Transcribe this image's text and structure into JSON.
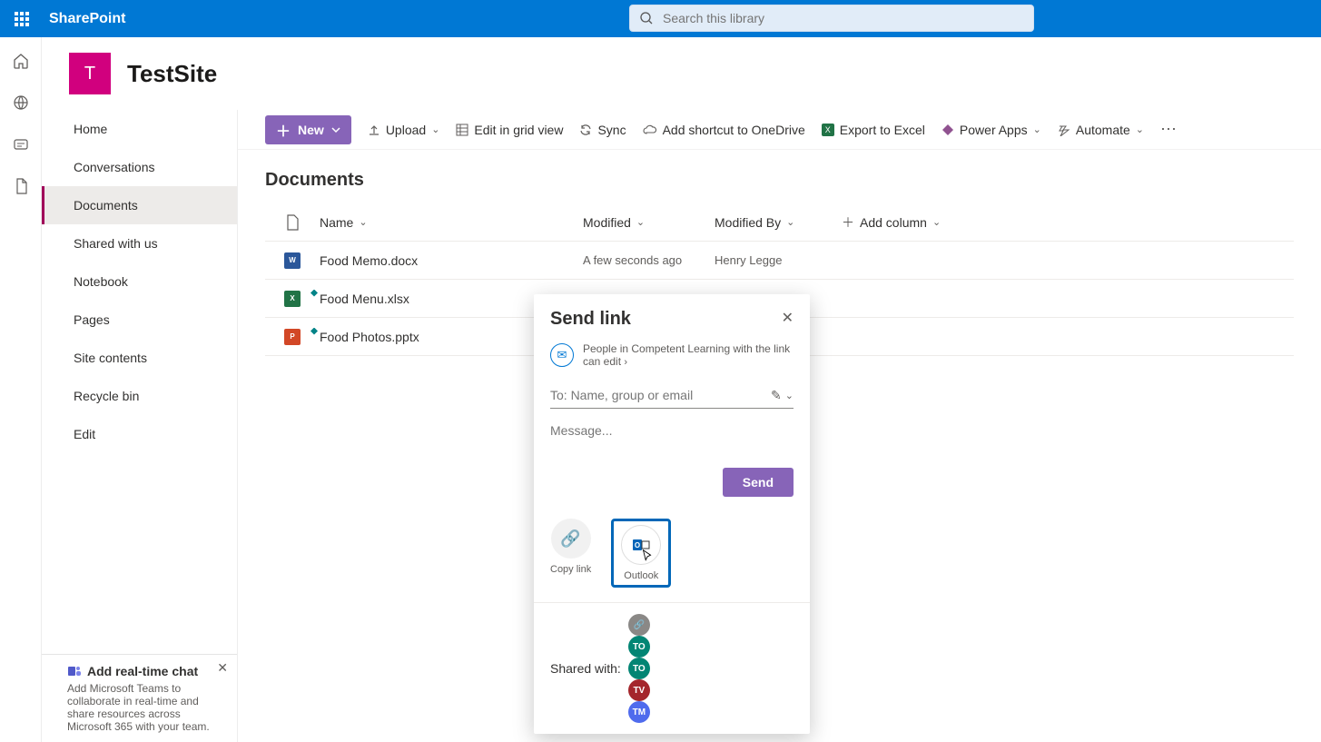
{
  "brand": "SharePoint",
  "search": {
    "placeholder": "Search this library"
  },
  "site": {
    "initial": "T",
    "title": "TestSite"
  },
  "nav": {
    "items": [
      {
        "label": "Home"
      },
      {
        "label": "Conversations"
      },
      {
        "label": "Documents",
        "active": true
      },
      {
        "label": "Shared with us"
      },
      {
        "label": "Notebook"
      },
      {
        "label": "Pages"
      },
      {
        "label": "Site contents"
      },
      {
        "label": "Recycle bin"
      },
      {
        "label": "Edit"
      }
    ]
  },
  "promo": {
    "title": "Add real-time chat",
    "body": "Add Microsoft Teams to collaborate in real-time and share resources across Microsoft 365 with your team."
  },
  "cmd": {
    "new": "New",
    "upload": "Upload",
    "grid": "Edit in grid view",
    "sync": "Sync",
    "shortcut": "Add shortcut to OneDrive",
    "excel": "Export to Excel",
    "power": "Power Apps",
    "automate": "Automate"
  },
  "library": {
    "title": "Documents",
    "cols": {
      "name": "Name",
      "modified": "Modified",
      "by": "Modified By",
      "add": "Add column"
    },
    "rows": [
      {
        "icon": "word",
        "name": "Food Memo.docx",
        "modified": "A few seconds ago",
        "by": "Henry Legge",
        "new": false
      },
      {
        "icon": "excel",
        "name": "Food Menu.xlsx",
        "modified": "",
        "by": "",
        "new": true
      },
      {
        "icon": "ppt",
        "name": "Food Photos.pptx",
        "modified": "",
        "by": "",
        "new": true
      }
    ]
  },
  "dialog": {
    "title": "Send link",
    "scope": "People in Competent Learning with the link can edit",
    "to_placeholder": "To: Name, group or email",
    "msg_placeholder": "Message...",
    "send": "Send",
    "copy": "Copy link",
    "outlook": "Outlook",
    "shared_label": "Shared with:",
    "chips": [
      {
        "cls": "chip-gray",
        "txt": "🔗"
      },
      {
        "cls": "chip-teal",
        "txt": "TO"
      },
      {
        "cls": "chip-teal",
        "txt": "TO"
      },
      {
        "cls": "chip-red",
        "txt": "TV"
      },
      {
        "cls": "chip-blue",
        "txt": "TM"
      }
    ]
  }
}
